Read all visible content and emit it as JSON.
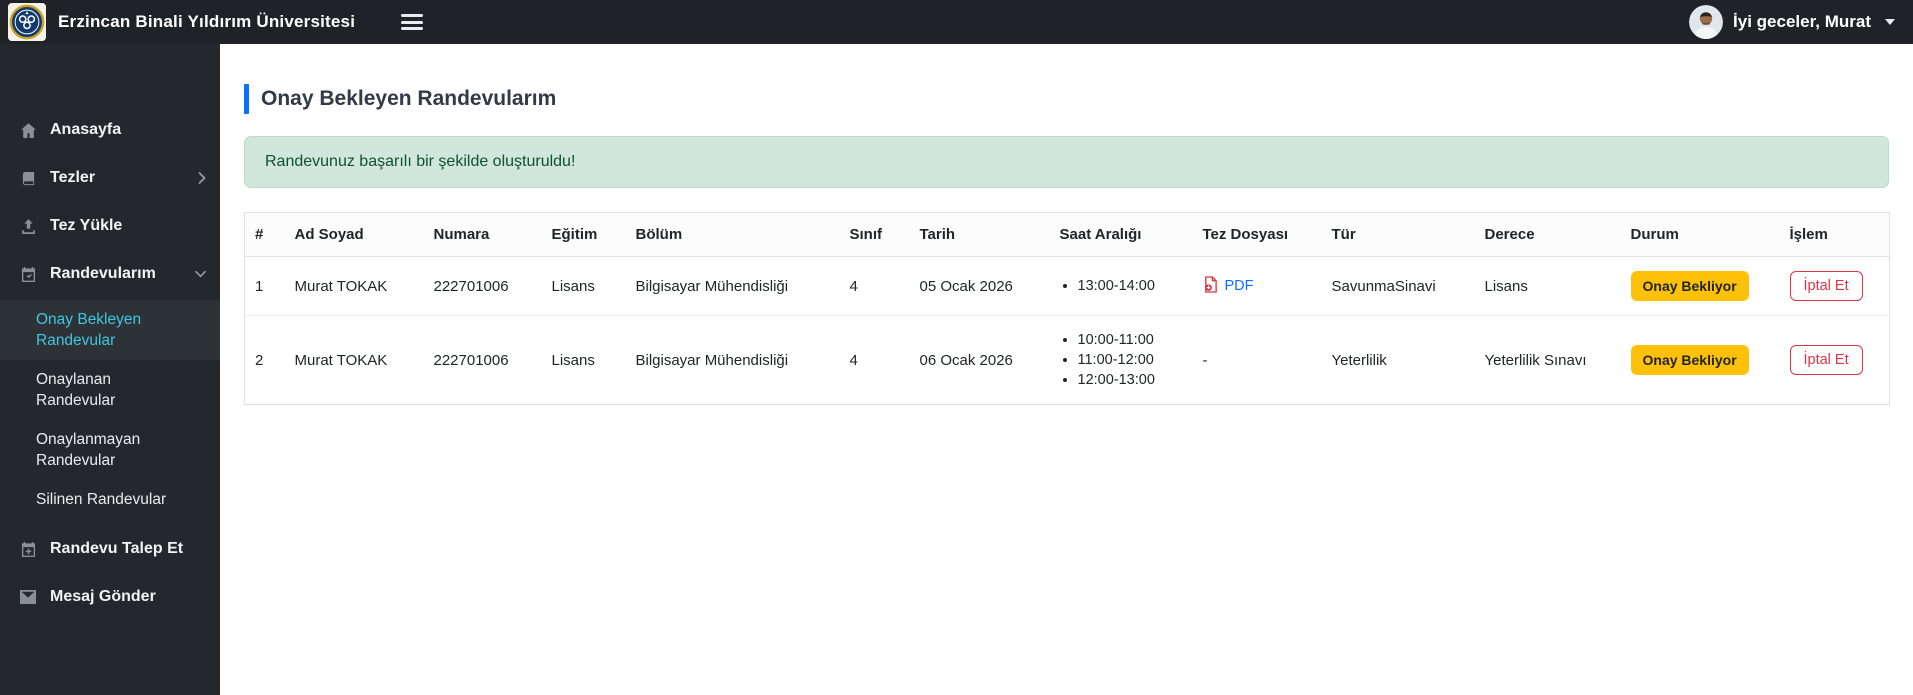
{
  "navbar": {
    "title": "Erzincan Binali Yıldırım Üniversitesi",
    "greeting": "İyi geceler, Murat"
  },
  "sidebar": {
    "items": [
      {
        "id": "anasayfa",
        "label": "Anasayfa",
        "icon": "home-icon"
      },
      {
        "id": "tezler",
        "label": "Tezler",
        "icon": "book-icon",
        "chevron": "right"
      },
      {
        "id": "tez-yukle",
        "label": "Tez Yükle",
        "icon": "upload-icon"
      },
      {
        "id": "randevularim",
        "label": "Randevularım",
        "icon": "calendar-check-icon",
        "chevron": "down",
        "children": [
          {
            "id": "onay-bekleyen-randevular",
            "label": "Onay Bekleyen\nRandevular",
            "active": true
          },
          {
            "id": "onaylanan-randevular",
            "label": "Onaylanan Randevular",
            "active": false
          },
          {
            "id": "onaylanmayan-randevular",
            "label": "Onaylanmayan\nRandevular",
            "active": false
          },
          {
            "id": "silinen-randevular",
            "label": "Silinen Randevular",
            "active": false
          }
        ]
      },
      {
        "id": "randevu-talep-et",
        "label": "Randevu Talep Et",
        "icon": "calendar-plus-icon"
      },
      {
        "id": "mesaj-gonder",
        "label": "Mesaj Gönder",
        "icon": "envelope-icon"
      }
    ]
  },
  "main": {
    "page_title": "Onay Bekleyen Randevularım",
    "alert_message": "Randevunuz başarılı bir şekilde oluşturuldu!",
    "table": {
      "headers": [
        "#",
        "Ad Soyad",
        "Numara",
        "Eğitim",
        "Bölüm",
        "Sınıf",
        "Tarih",
        "Saat Aralığı",
        "Tez Dosyası",
        "Tür",
        "Derece",
        "Durum",
        "İşlem"
      ],
      "rows": [
        {
          "index": "1",
          "name": "Murat TOKAK",
          "number": "222701006",
          "education": "Lisans",
          "department": "Bilgisayar Mühendisliği",
          "class": "4",
          "date": "05 Ocak 2026",
          "times": [
            "13:00-14:00"
          ],
          "has_pdf": true,
          "thesis_file": "PDF",
          "type": "SavunmaSinavi",
          "degree": "Lisans",
          "status": "Onay Bekliyor",
          "action": "İptal Et"
        },
        {
          "index": "2",
          "name": "Murat TOKAK",
          "number": "222701006",
          "education": "Lisans",
          "department": "Bilgisayar Mühendisliği",
          "class": "4",
          "date": "06 Ocak 2026",
          "times": [
            "10:00-11:00",
            "11:00-12:00",
            "12:00-13:00"
          ],
          "has_pdf": false,
          "thesis_file": "-",
          "type": "Yeterlilik",
          "degree": "Yeterlilik Sınavı",
          "status": "Onay Bekliyor",
          "action": "İptal Et"
        }
      ]
    }
  },
  "colors": {
    "navbar_bg": "#1f2327",
    "sidebar_bg": "#24282c",
    "sidebar_active_bg": "#2d3237",
    "accent_cyan": "#3fc6e0",
    "accent_blue": "#0d6efd",
    "alert_bg": "#d1e7dd",
    "alert_text": "#0f5132",
    "badge_yellow": "#ffc107",
    "danger_red": "#dc3545",
    "link_blue": "#0d6efd",
    "border": "#dee2e6"
  }
}
